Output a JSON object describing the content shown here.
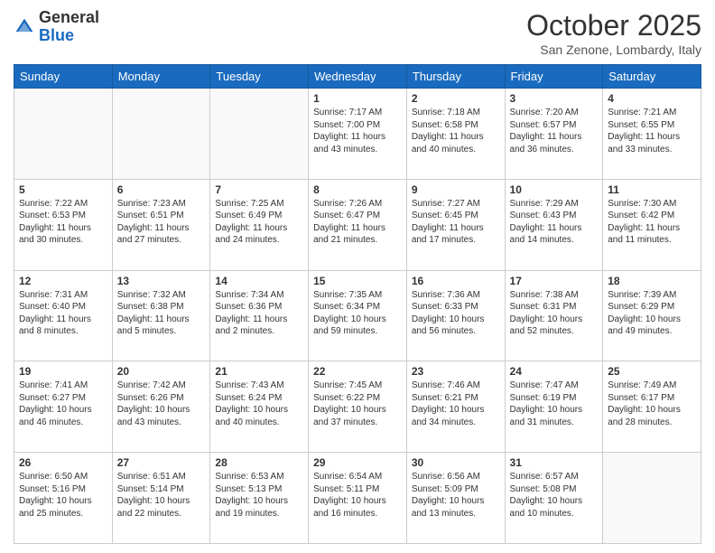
{
  "header": {
    "logo_general": "General",
    "logo_blue": "Blue",
    "month_title": "October 2025",
    "location": "San Zenone, Lombardy, Italy"
  },
  "days_of_week": [
    "Sunday",
    "Monday",
    "Tuesday",
    "Wednesday",
    "Thursday",
    "Friday",
    "Saturday"
  ],
  "weeks": [
    [
      {
        "day": "",
        "content": ""
      },
      {
        "day": "",
        "content": ""
      },
      {
        "day": "",
        "content": ""
      },
      {
        "day": "1",
        "content": "Sunrise: 7:17 AM\nSunset: 7:00 PM\nDaylight: 11 hours and 43 minutes."
      },
      {
        "day": "2",
        "content": "Sunrise: 7:18 AM\nSunset: 6:58 PM\nDaylight: 11 hours and 40 minutes."
      },
      {
        "day": "3",
        "content": "Sunrise: 7:20 AM\nSunset: 6:57 PM\nDaylight: 11 hours and 36 minutes."
      },
      {
        "day": "4",
        "content": "Sunrise: 7:21 AM\nSunset: 6:55 PM\nDaylight: 11 hours and 33 minutes."
      }
    ],
    [
      {
        "day": "5",
        "content": "Sunrise: 7:22 AM\nSunset: 6:53 PM\nDaylight: 11 hours and 30 minutes."
      },
      {
        "day": "6",
        "content": "Sunrise: 7:23 AM\nSunset: 6:51 PM\nDaylight: 11 hours and 27 minutes."
      },
      {
        "day": "7",
        "content": "Sunrise: 7:25 AM\nSunset: 6:49 PM\nDaylight: 11 hours and 24 minutes."
      },
      {
        "day": "8",
        "content": "Sunrise: 7:26 AM\nSunset: 6:47 PM\nDaylight: 11 hours and 21 minutes."
      },
      {
        "day": "9",
        "content": "Sunrise: 7:27 AM\nSunset: 6:45 PM\nDaylight: 11 hours and 17 minutes."
      },
      {
        "day": "10",
        "content": "Sunrise: 7:29 AM\nSunset: 6:43 PM\nDaylight: 11 hours and 14 minutes."
      },
      {
        "day": "11",
        "content": "Sunrise: 7:30 AM\nSunset: 6:42 PM\nDaylight: 11 hours and 11 minutes."
      }
    ],
    [
      {
        "day": "12",
        "content": "Sunrise: 7:31 AM\nSunset: 6:40 PM\nDaylight: 11 hours and 8 minutes."
      },
      {
        "day": "13",
        "content": "Sunrise: 7:32 AM\nSunset: 6:38 PM\nDaylight: 11 hours and 5 minutes."
      },
      {
        "day": "14",
        "content": "Sunrise: 7:34 AM\nSunset: 6:36 PM\nDaylight: 11 hours and 2 minutes."
      },
      {
        "day": "15",
        "content": "Sunrise: 7:35 AM\nSunset: 6:34 PM\nDaylight: 10 hours and 59 minutes."
      },
      {
        "day": "16",
        "content": "Sunrise: 7:36 AM\nSunset: 6:33 PM\nDaylight: 10 hours and 56 minutes."
      },
      {
        "day": "17",
        "content": "Sunrise: 7:38 AM\nSunset: 6:31 PM\nDaylight: 10 hours and 52 minutes."
      },
      {
        "day": "18",
        "content": "Sunrise: 7:39 AM\nSunset: 6:29 PM\nDaylight: 10 hours and 49 minutes."
      }
    ],
    [
      {
        "day": "19",
        "content": "Sunrise: 7:41 AM\nSunset: 6:27 PM\nDaylight: 10 hours and 46 minutes."
      },
      {
        "day": "20",
        "content": "Sunrise: 7:42 AM\nSunset: 6:26 PM\nDaylight: 10 hours and 43 minutes."
      },
      {
        "day": "21",
        "content": "Sunrise: 7:43 AM\nSunset: 6:24 PM\nDaylight: 10 hours and 40 minutes."
      },
      {
        "day": "22",
        "content": "Sunrise: 7:45 AM\nSunset: 6:22 PM\nDaylight: 10 hours and 37 minutes."
      },
      {
        "day": "23",
        "content": "Sunrise: 7:46 AM\nSunset: 6:21 PM\nDaylight: 10 hours and 34 minutes."
      },
      {
        "day": "24",
        "content": "Sunrise: 7:47 AM\nSunset: 6:19 PM\nDaylight: 10 hours and 31 minutes."
      },
      {
        "day": "25",
        "content": "Sunrise: 7:49 AM\nSunset: 6:17 PM\nDaylight: 10 hours and 28 minutes."
      }
    ],
    [
      {
        "day": "26",
        "content": "Sunrise: 6:50 AM\nSunset: 5:16 PM\nDaylight: 10 hours and 25 minutes."
      },
      {
        "day": "27",
        "content": "Sunrise: 6:51 AM\nSunset: 5:14 PM\nDaylight: 10 hours and 22 minutes."
      },
      {
        "day": "28",
        "content": "Sunrise: 6:53 AM\nSunset: 5:13 PM\nDaylight: 10 hours and 19 minutes."
      },
      {
        "day": "29",
        "content": "Sunrise: 6:54 AM\nSunset: 5:11 PM\nDaylight: 10 hours and 16 minutes."
      },
      {
        "day": "30",
        "content": "Sunrise: 6:56 AM\nSunset: 5:09 PM\nDaylight: 10 hours and 13 minutes."
      },
      {
        "day": "31",
        "content": "Sunrise: 6:57 AM\nSunset: 5:08 PM\nDaylight: 10 hours and 10 minutes."
      },
      {
        "day": "",
        "content": ""
      }
    ]
  ]
}
